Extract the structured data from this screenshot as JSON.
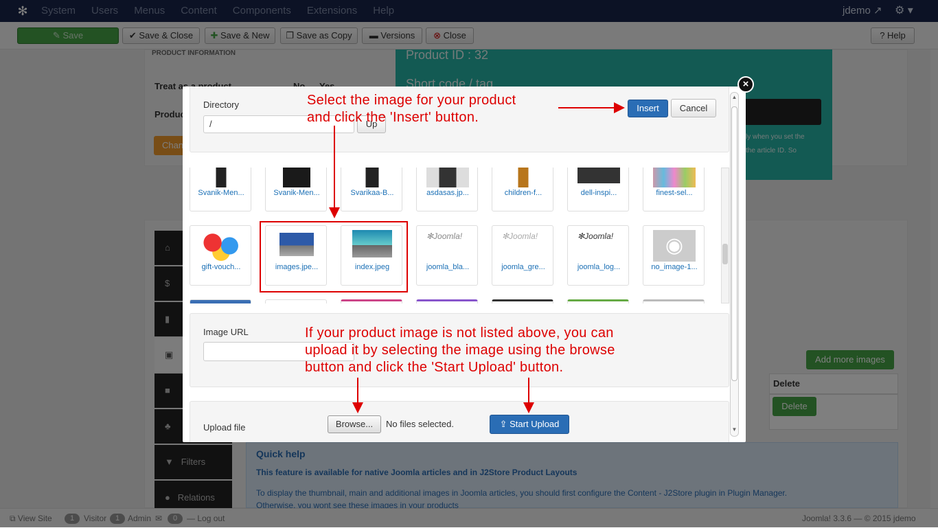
{
  "navbar": {
    "menu": [
      "System",
      "Users",
      "Menus",
      "Content",
      "Components",
      "Extensions",
      "Help"
    ],
    "user": "jdemo"
  },
  "toolbar": {
    "save": "Save",
    "save_close": "Save & Close",
    "save_new": "Save & New",
    "save_copy": "Save as Copy",
    "versions": "Versions",
    "close": "Close",
    "help": "Help"
  },
  "background": {
    "product_info": "PRODUCT INFORMATION",
    "treat_as_product": "Treat as a product",
    "no": "No",
    "yes": "Yes",
    "product_label": "Produc",
    "change_btn": "Chan",
    "product_id": "Product ID : 32",
    "short_code": "Short code / tag",
    "teal_note1": "ly when you set the",
    "teal_note2": "the article ID. So",
    "sidebar": [
      "Filters",
      "Relations"
    ],
    "add_more_images": "Add more images",
    "delete_header": "Delete",
    "delete_btn": "Delete",
    "quick_help_title": "Quick help",
    "quick_help_bold": "This feature is available for native Joomla articles and in J2Store Product Layouts",
    "quick_help_text": "To display the thumbnail, main and additional images in Joomla articles, you should first configure the Content - J2Store plugin in Plugin Manager.",
    "quick_help_text2": "Otherwise, you wont see these images in your products"
  },
  "footer": {
    "view_site": "View Site",
    "visitor_count": "1",
    "visitor": "Visitor",
    "admin_count": "1",
    "admin": "Admin",
    "msg_count": "0",
    "logout": "Log out",
    "copyright": "Joomla! 3.3.6 — © 2015 jdemo"
  },
  "modal": {
    "directory_label": "Directory",
    "directory_value": "/",
    "up_btn": "Up",
    "insert_btn": "Insert",
    "cancel_btn": "Cancel",
    "images_row1": [
      "Svanik-Men...",
      "Svanik-Men...",
      "Svarikaa-B...",
      "asdasas.jp...",
      "children-f...",
      "dell-inspi...",
      "finest-sel..."
    ],
    "images_row2": [
      "gift-vouch...",
      "images.jpe...",
      "index.jpeg",
      "joomla_bla...",
      "joomla_gre...",
      "joomla_log...",
      "no_image-1..."
    ],
    "image_url_label": "Image URL",
    "upload_label": "Upload file",
    "browse_btn": "Browse...",
    "no_files": "No files selected.",
    "start_upload": "Start Upload"
  },
  "annotations": {
    "top_line1": "Select the image for your product",
    "top_line2": "and click the 'Insert' button.",
    "bottom_line1": "If your product image is not listed above, you can",
    "bottom_line2": "upload it by selecting the image using the browse",
    "bottom_line3": "button and click the 'Start Upload' button."
  },
  "colors": {
    "navbar": "#18254a",
    "teal": "#27b4a7",
    "primary": "#2a6db5",
    "annotation": "#dd0000"
  }
}
